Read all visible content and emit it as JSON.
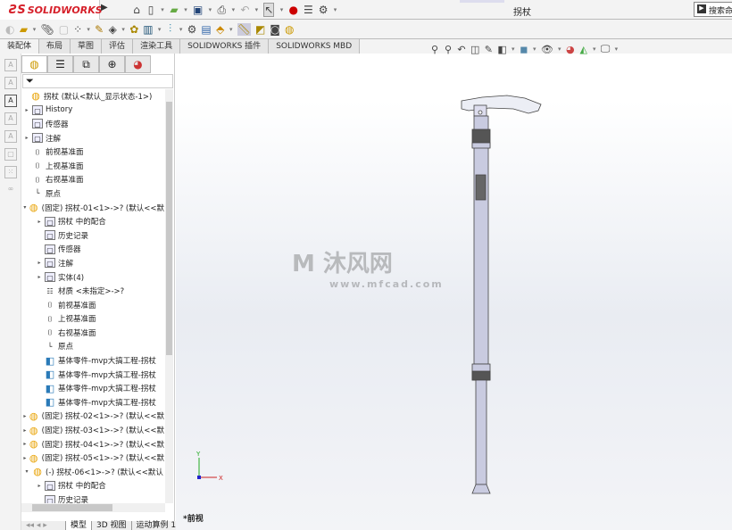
{
  "app": {
    "brand": "SOLIDWORKS",
    "doc_title": "拐杖",
    "search_placeholder": "搜索命"
  },
  "toolbar1": {
    "icons": [
      "home-icon",
      "new-icon",
      "open-icon",
      "save-icon",
      "print-icon",
      "undo-icon",
      "select-icon",
      "rebuild-icon",
      "file-properties-icon",
      "options-icon"
    ]
  },
  "toolbar2": {
    "icons": [
      "edit-component-icon",
      "insert-components-icon",
      "mate-icon",
      "component-preview-icon",
      "linear-pattern-icon",
      "smart-fasteners-icon",
      "move-component-icon",
      "show-hidden-icon",
      "assembly-features-icon",
      "reference-geometry-icon",
      "new-motion-study-icon",
      "bill-of-materials-icon",
      "exploded-view-icon",
      "instant3d-icon",
      "update-speedpak-icon",
      "snapshot-icon",
      "large-assembly-icon"
    ]
  },
  "command_tabs": [
    "装配体",
    "布局",
    "草图",
    "评估",
    "渲染工具",
    "SOLIDWORKS 插件",
    "SOLIDWORKS MBD"
  ],
  "panel_tabs": [
    "featuremanager-icon",
    "propertymanager-icon",
    "configurationmanager-icon",
    "dimxpert-icon",
    "displaymanager-icon"
  ],
  "tree": [
    {
      "label": "拐杖  (默认<默认_显示状态-1>)",
      "icon": "assembly",
      "level": 0,
      "exp": ""
    },
    {
      "label": "History",
      "icon": "folder",
      "level": 1,
      "exp": "▸"
    },
    {
      "label": "传感器",
      "icon": "folder",
      "level": 1,
      "exp": ""
    },
    {
      "label": "注解",
      "icon": "folder",
      "level": 1,
      "exp": "▸"
    },
    {
      "label": "前视基准面",
      "icon": "plane",
      "level": 1,
      "exp": ""
    },
    {
      "label": "上视基准面",
      "icon": "plane",
      "level": 1,
      "exp": ""
    },
    {
      "label": "右视基准面",
      "icon": "plane",
      "level": 1,
      "exp": ""
    },
    {
      "label": "原点",
      "icon": "origin",
      "level": 1,
      "exp": ""
    },
    {
      "label": "(固定) 拐杖-01<1>->? (默认<<默",
      "icon": "assembly-yellow",
      "level": 1,
      "exp": "▾"
    },
    {
      "label": "拐杖 中的配合",
      "icon": "folder",
      "level": 2,
      "exp": "▸"
    },
    {
      "label": "历史记录",
      "icon": "folder",
      "level": 2,
      "exp": ""
    },
    {
      "label": "传感器",
      "icon": "folder",
      "level": 2,
      "exp": ""
    },
    {
      "label": "注解",
      "icon": "folder",
      "level": 2,
      "exp": "▸"
    },
    {
      "label": "实体(4)",
      "icon": "folder",
      "level": 2,
      "exp": "▸"
    },
    {
      "label": "材质 <未指定>->?",
      "icon": "material",
      "level": 2,
      "exp": ""
    },
    {
      "label": "前视基准面",
      "icon": "plane",
      "level": 2,
      "exp": ""
    },
    {
      "label": "上视基准面",
      "icon": "plane",
      "level": 2,
      "exp": ""
    },
    {
      "label": "右视基准面",
      "icon": "plane",
      "level": 2,
      "exp": ""
    },
    {
      "label": "原点",
      "icon": "origin",
      "level": 2,
      "exp": ""
    },
    {
      "label": "基体零件-mvp大搞工程-拐杖",
      "icon": "part",
      "level": 2,
      "exp": ""
    },
    {
      "label": "基体零件-mvp大搞工程-拐杖",
      "icon": "part",
      "level": 2,
      "exp": ""
    },
    {
      "label": "基体零件-mvp大搞工程-拐杖",
      "icon": "part",
      "level": 2,
      "exp": ""
    },
    {
      "label": "基体零件-mvp大搞工程-拐杖",
      "icon": "part",
      "level": 2,
      "exp": ""
    },
    {
      "label": "(固定) 拐杖-02<1>->? (默认<<默",
      "icon": "assembly-yellow",
      "level": 1,
      "exp": "▸"
    },
    {
      "label": "(固定) 拐杖-03<1>->? (默认<<默",
      "icon": "assembly-yellow",
      "level": 1,
      "exp": "▸"
    },
    {
      "label": "(固定) 拐杖-04<1>->? (默认<<默",
      "icon": "assembly-yellow",
      "level": 1,
      "exp": "▸"
    },
    {
      "label": "(固定) 拐杖-05<1>->? (默认<<默",
      "icon": "assembly-yellow",
      "level": 1,
      "exp": "▸"
    },
    {
      "label": "(-) 拐杖-06<1>->? (默认<<默认",
      "icon": "assembly-yellow",
      "level": 1,
      "exp": "▾"
    },
    {
      "label": "拐杖 中的配合",
      "icon": "folder",
      "level": 2,
      "exp": "▸"
    },
    {
      "label": "历史记录",
      "icon": "folder",
      "level": 2,
      "exp": ""
    }
  ],
  "bottom_tabs": [
    "模型",
    "3D 视图",
    "运动算例 1"
  ],
  "viewport": {
    "view_name": "*前视",
    "triad_labels": {
      "x": "X",
      "y": "Y"
    },
    "watermark": {
      "text": "沐风网",
      "url": "www.mfcad.com"
    },
    "view_toolbar": [
      "zoom-to-fit-icon",
      "zoom-area-icon",
      "previous-view-icon",
      "section-view-icon",
      "dynamic-annotation-icon",
      "view-orientation-icon",
      "display-style-icon",
      "hide-show-icon",
      "edit-appearance-icon",
      "apply-scene-icon",
      "view-settings-icon"
    ]
  },
  "colors": {
    "brand_red": "#d6202a",
    "assembly_icon": "#e8a100",
    "part_icon": "#2a7ab8",
    "cane_body": "#c9cbe0"
  }
}
